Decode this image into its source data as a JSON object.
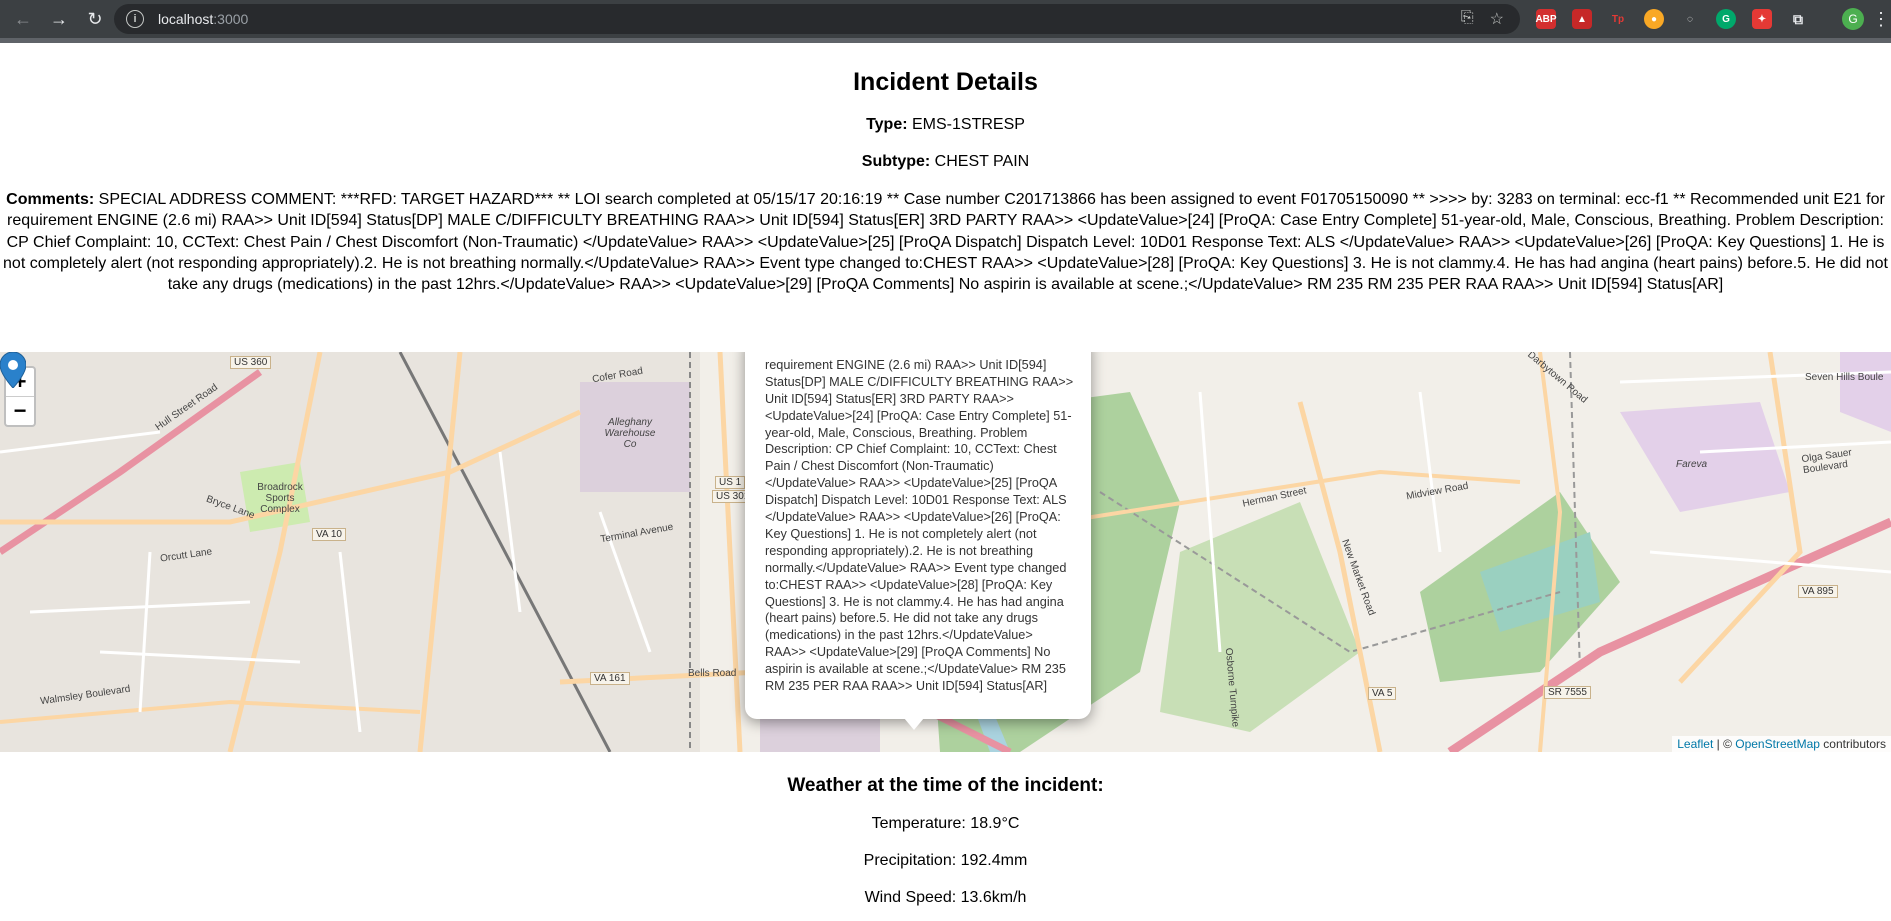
{
  "browser": {
    "url_host": "localhost",
    "url_port": ":3000",
    "profile_initial": "G"
  },
  "incident": {
    "title": "Incident Details",
    "type_label": "Type:",
    "type_value": "EMS-1STRESP",
    "subtype_label": "Subtype:",
    "subtype_value": "CHEST PAIN",
    "comments_label": "Comments:",
    "comments_value": "SPECIAL ADDRESS COMMENT: ***RFD: TARGET HAZARD*** ** LOI search completed at 05/15/17 20:16:19 ** Case number C201713866 has been assigned to event F01705150090 ** >>>> by: 3283 on terminal: ecc-f1 ** Recommended unit E21 for requirement ENGINE (2.6 mi) RAA>> Unit ID[594] Status[DP] MALE C/DIFFICULTY BREATHING RAA>> Unit ID[594] Status[ER] 3RD PARTY RAA>> <UpdateValue>[24] [ProQA: Case Entry Complete] 51-year-old, Male, Conscious, Breathing. Problem Description: CP Chief Complaint: 10, CCText: Chest Pain / Chest Discomfort (Non-Traumatic) </UpdateValue> RAA>> <UpdateValue>[25] [ProQA Dispatch] Dispatch Level: 10D01 Response Text: ALS </UpdateValue> RAA>> <UpdateValue>[26] [ProQA: Key Questions] 1. He is not completely alert (not responding appropriately).2. He is not breathing normally.</UpdateValue> RAA>> Event type changed to:CHEST RAA>> <UpdateValue>[28] [ProQA: Key Questions] 3. He is not clammy.4. He has had angina (heart pains) before.5. He did not take any drugs (medications) in the past 12hrs.</UpdateValue> RAA>> <UpdateValue>[29] [ProQA Comments] No aspirin is available at scene.;</UpdateValue> RM 235 RM 235 PER RAA RAA>> Unit ID[594] Status[AR]"
  },
  "map": {
    "zoom_in": "+",
    "zoom_out": "−",
    "popup_text": "requirement ENGINE (2.6 mi) RAA>> Unit ID[594] Status[DP] MALE C/DIFFICULTY BREATHING RAA>> Unit ID[594] Status[ER] 3RD PARTY RAA>> <UpdateValue>[24] [ProQA: Case Entry Complete] 51-year-old, Male, Conscious, Breathing. Problem Description: CP Chief Complaint: 10, CCText: Chest Pain / Chest Discomfort (Non-Traumatic) </UpdateValue> RAA>> <UpdateValue>[25] [ProQA Dispatch] Dispatch Level: 10D01 Response Text: ALS </UpdateValue> RAA>> <UpdateValue>[26] [ProQA: Key Questions] 1. He is not completely alert (not responding appropriately).2. He is not breathing normally.</UpdateValue> RAA>> Event type changed to:CHEST RAA>> <UpdateValue>[28] [ProQA: Key Questions] 3. He is not clammy.4. He has had angina (heart pains) before.5. He did not take any drugs (medications) in the past 12hrs.</UpdateValue> RAA>> <UpdateValue>[29] [ProQA Comments] No aspirin is available at scene.;</UpdateValue> RM 235 RM 235 PER RAA RAA>> Unit ID[594] Status[AR]",
    "attribution_leaflet": "Leaflet",
    "attribution_sep": " | © ",
    "attribution_osm": "OpenStreetMap",
    "attribution_tail": " contributors",
    "labels": {
      "us360": "US 360",
      "hull": "Hull Street Road",
      "broadrock": "Broadrock Sports Complex",
      "va10": "VA 10",
      "alleghany": "Alleghany Warehouse Co",
      "us1": "US 1",
      "us301": "US 301",
      "terminal": "Terminal Avenue",
      "va161": "VA 161",
      "bells": "Bells Road",
      "herman": "Herman Street",
      "midview": "Midview Road",
      "fareva": "Fareva",
      "va895": "VA 895",
      "va5": "VA 5",
      "sr7555": "SR 7555",
      "walmsley": "Walmsley Boulevard",
      "cofer": "Cofer Road",
      "darbytown": "Darbytown Road",
      "sevenhills": "Seven Hills Boule",
      "olgasauer": "Olga Sauer Boulevard",
      "newmarket": "New Market Road",
      "osborne": "Osborne Turnpike",
      "orcutt": "Orcutt Lane",
      "bryce": "Bryce Lane"
    }
  },
  "weather": {
    "heading": "Weather at the time of the incident:",
    "temperature": "Temperature: 18.9°C",
    "precipitation": "Precipitation: 192.4mm",
    "wind": "Wind Speed: 13.6km/h"
  },
  "colors": {
    "chrome": "#3c4043",
    "map_land": "#f2efe9",
    "park": "#cdebb0",
    "motorway": "#e892a2",
    "primary": "#fcd6a4",
    "marker": "#2a81cb"
  }
}
